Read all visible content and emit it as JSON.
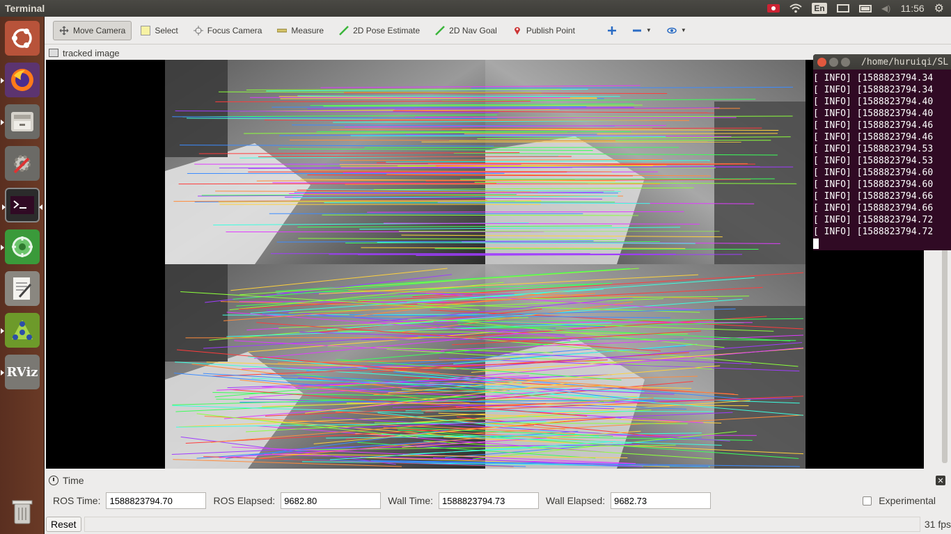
{
  "top_panel": {
    "title": "Terminal",
    "lang": "En",
    "clock": "11:56"
  },
  "launcher": {
    "items": [
      {
        "name": "ubuntu-dash-icon"
      },
      {
        "name": "firefox-icon"
      },
      {
        "name": "files-icon"
      },
      {
        "name": "settings-icon"
      },
      {
        "name": "terminal-icon"
      },
      {
        "name": "qtcreator-icon"
      },
      {
        "name": "text-editor-icon"
      },
      {
        "name": "rqt-icon"
      },
      {
        "name": "rviz-icon",
        "label": "RViz"
      },
      {
        "name": "trash-icon"
      }
    ]
  },
  "toolbar": {
    "move_camera": "Move Camera",
    "select": "Select",
    "focus_camera": "Focus Camera",
    "measure": "Measure",
    "pose_estimate": "2D Pose Estimate",
    "nav_goal": "2D Nav Goal",
    "publish_point": "Publish Point"
  },
  "image_panel": {
    "title": "tracked image"
  },
  "terminal": {
    "path": "/home/huruiqi/SL",
    "lines": [
      "[ INFO] [1588823794.34",
      "[ INFO] [1588823794.34",
      "[ INFO] [1588823794.40",
      "[ INFO] [1588823794.40",
      "[ INFO] [1588823794.46",
      "[ INFO] [1588823794.46",
      "[ INFO] [1588823794.53",
      "[ INFO] [1588823794.53",
      "[ INFO] [1588823794.60",
      "[ INFO] [1588823794.60",
      "[ INFO] [1588823794.66",
      "[ INFO] [1588823794.66",
      "[ INFO] [1588823794.72",
      "[ INFO] [1588823794.72"
    ]
  },
  "time_panel": {
    "title": "Time",
    "ros_time_label": "ROS Time:",
    "ros_time": "1588823794.70",
    "ros_elapsed_label": "ROS Elapsed:",
    "ros_elapsed": "9682.80",
    "wall_time_label": "Wall Time:",
    "wall_time": "1588823794.73",
    "wall_elapsed_label": "Wall Elapsed:",
    "wall_elapsed": "9682.73",
    "experimental": "Experimental",
    "reset": "Reset",
    "fps": "31 fps"
  }
}
